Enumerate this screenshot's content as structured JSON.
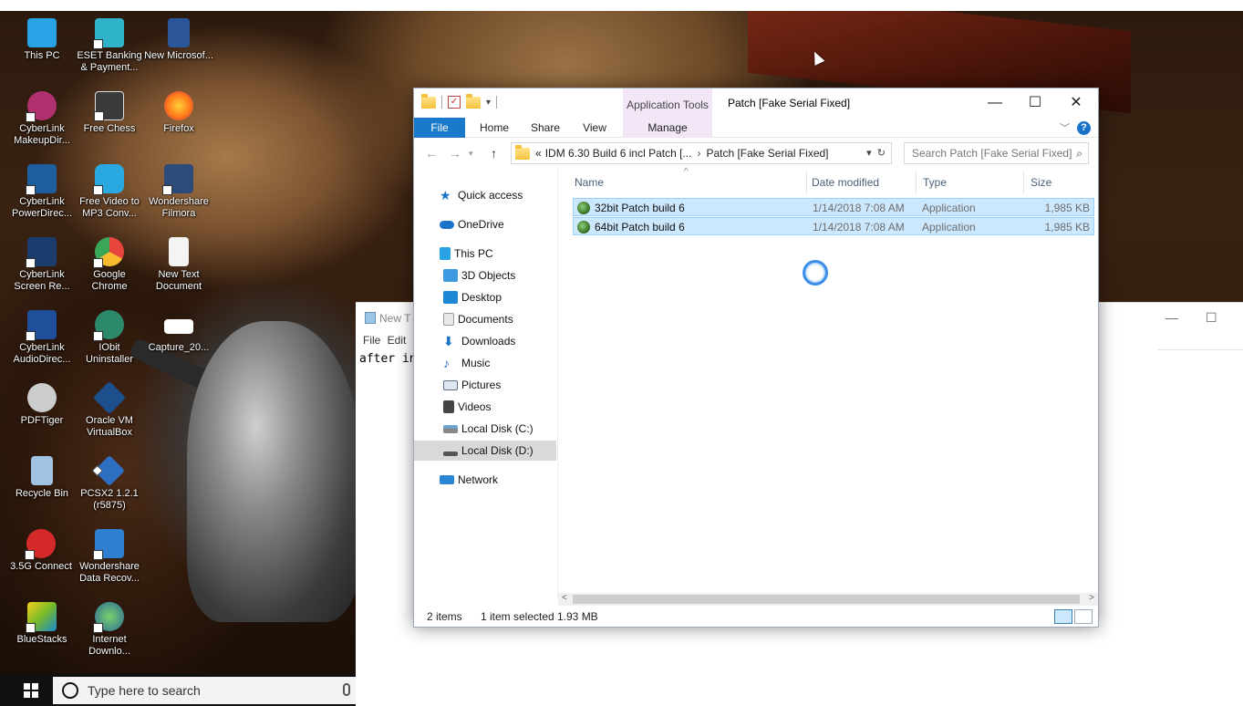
{
  "desktop": {
    "icons": [
      {
        "label": "This PC",
        "icon": "this-pc-icon",
        "color": "#29a3e6"
      },
      {
        "label": "ESET Banking & Payment...",
        "icon": "eset-icon",
        "color": "#2fb3c8"
      },
      {
        "label": "New Microsof...",
        "icon": "word-doc-icon",
        "color": "#2b579a"
      },
      {
        "label": "CyberLink MakeupDir...",
        "icon": "makeup-icon",
        "color": "#b03070"
      },
      {
        "label": "Free Chess",
        "icon": "chess-icon",
        "color": "#dddddd"
      },
      {
        "label": "Firefox",
        "icon": "firefox-icon",
        "color": "#ff7a1a"
      },
      {
        "label": "CyberLink PowerDirec...",
        "icon": "powerdirector-icon",
        "color": "#1d5f9e"
      },
      {
        "label": "Free Video to MP3 Conv...",
        "icon": "mp3-converter-icon",
        "color": "#2aa8e0"
      },
      {
        "label": "Wondershare Filmora",
        "icon": "filmora-icon",
        "color": "#2e4a7a"
      },
      {
        "label": "CyberLink Screen Re...",
        "icon": "screen-recorder-icon",
        "color": "#1b3d6e"
      },
      {
        "label": "Google Chrome",
        "icon": "chrome-icon",
        "color": "#e8453c"
      },
      {
        "label": "New Text Document",
        "icon": "text-doc-icon",
        "color": "#f4f4f4"
      },
      {
        "label": "CyberLink AudioDirec...",
        "icon": "audiodirector-icon",
        "color": "#1f4f9a"
      },
      {
        "label": "IObit Uninstaller",
        "icon": "iobit-icon",
        "color": "#2c8a6a"
      },
      {
        "label": "Capture_20...",
        "icon": "capture-image-icon",
        "color": "#ffffff"
      },
      {
        "label": "PDFTiger",
        "icon": "pdftiger-icon",
        "color": "#cccccc"
      },
      {
        "label": "Oracle VM VirtualBox",
        "icon": "virtualbox-icon",
        "color": "#1c4f8c"
      },
      {
        "label": "Recycle Bin",
        "icon": "recycle-bin-icon",
        "color": "#9fc3e0"
      },
      {
        "label": "PCSX2 1.2.1 (r5875)",
        "icon": "pcsx2-icon",
        "color": "#2c6ec2"
      },
      {
        "label": "3.5G Connect",
        "icon": "connect-3g-icon",
        "color": "#d42a2a"
      },
      {
        "label": "Wondershare Data Recov...",
        "icon": "data-recovery-icon",
        "color": "#2f7fd1"
      },
      {
        "label": "BlueStacks",
        "icon": "bluestacks-icon",
        "color": "#76b82a"
      },
      {
        "label": "Internet Downlo...",
        "icon": "idm-icon",
        "color": "#3a9a3a"
      }
    ]
  },
  "taskbar": {
    "search_placeholder": "Type here to search"
  },
  "notepad": {
    "title": "New T",
    "menu": "File  Edit",
    "content": "after in"
  },
  "explorer": {
    "app_tools_label": "Application Tools",
    "title": "Patch [Fake Serial Fixed]",
    "ribbon_tabs": {
      "file": "File",
      "home": "Home",
      "share": "Share",
      "view": "View",
      "manage": "Manage"
    },
    "address": {
      "overflow": "«",
      "crumb1": "IDM 6.30 Build 6 incl Patch [...",
      "crumb2": "Patch [Fake Serial Fixed]"
    },
    "search_placeholder": "Search Patch [Fake Serial Fixed]",
    "nav": [
      {
        "label": "Quick access",
        "icon": "quick-access-star-icon",
        "color": "#1a73c9"
      },
      {
        "label": "OneDrive",
        "icon": "onedrive-cloud-icon",
        "color": "#1a73c9"
      },
      {
        "label": "This PC",
        "icon": "this-pc-icon",
        "color": "#29a3e6"
      },
      {
        "label": "3D Objects",
        "icon": "3d-objects-icon",
        "color": "#3d9ae0"
      },
      {
        "label": "Desktop",
        "icon": "desktop-icon",
        "color": "#1e88d4"
      },
      {
        "label": "Documents",
        "icon": "documents-icon",
        "color": "#c9c9c9"
      },
      {
        "label": "Downloads",
        "icon": "downloads-icon",
        "color": "#1a73c9"
      },
      {
        "label": "Music",
        "icon": "music-icon",
        "color": "#1a73c9"
      },
      {
        "label": "Pictures",
        "icon": "pictures-icon",
        "color": "#5a6f86"
      },
      {
        "label": "Videos",
        "icon": "videos-icon",
        "color": "#444444"
      },
      {
        "label": "Local Disk (C:)",
        "icon": "local-disk-c-icon",
        "color": "#6aa7d8"
      },
      {
        "label": "Local Disk (D:)",
        "icon": "local-disk-d-icon",
        "color": "#555555"
      },
      {
        "label": "Network",
        "icon": "network-icon",
        "color": "#2a86d3"
      }
    ],
    "columns": {
      "name": "Name",
      "date": "Date modified",
      "type": "Type",
      "size": "Size"
    },
    "files": [
      {
        "name": "32bit Patch build 6",
        "date": "1/14/2018 7:08 AM",
        "type": "Application",
        "size": "1,985 KB"
      },
      {
        "name": "64bit Patch build 6",
        "date": "1/14/2018 7:08 AM",
        "type": "Application",
        "size": "1,985 KB"
      }
    ],
    "status": {
      "count": "2 items",
      "selected": "1 item selected",
      "size": "1.93 MB"
    }
  }
}
